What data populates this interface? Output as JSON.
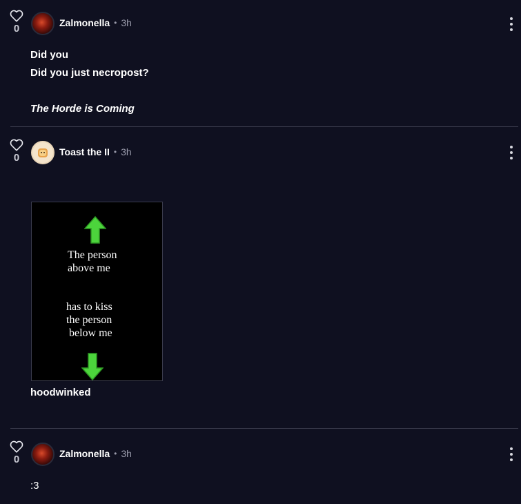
{
  "posts": [
    {
      "likes": "0",
      "author": "Zalmonella",
      "separator": "•",
      "time": "3h",
      "lines": [
        "Did you",
        "Did you just necropost?"
      ],
      "signature": "The Horde is Coming"
    },
    {
      "likes": "0",
      "author": "Toast the II",
      "separator": "•",
      "time": "3h",
      "meme_top": "The person\nabove me",
      "meme_bottom": "has to kiss\nthe person\n below me",
      "caption": "hoodwinked"
    },
    {
      "likes": "0",
      "author": "Zalmonella",
      "separator": "•",
      "time": "3h",
      "text": ":3"
    }
  ],
  "icons": {
    "like": "heart-outline-icon",
    "menu": "kebab-menu-icon",
    "arrow_up": "green-arrow-up-icon",
    "arrow_down": "green-arrow-down-icon"
  },
  "colors": {
    "background": "#0f1020",
    "divider": "#3a3b4c",
    "muted": "#9a9bab",
    "arrow_green": "#4cd43c"
  }
}
